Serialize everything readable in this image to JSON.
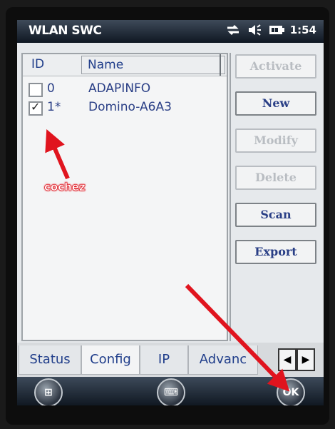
{
  "titlebar": {
    "title": "WLAN SWC",
    "time": "1:54",
    "icons": [
      "connectivity-icon",
      "volume-icon",
      "battery-icon"
    ]
  },
  "list": {
    "headers": {
      "id": "ID",
      "name": "Name"
    },
    "rows": [
      {
        "id": "0",
        "name": "ADAPINFO",
        "checked": false
      },
      {
        "id": "1*",
        "name": "Domino-A6A3",
        "checked": true
      }
    ]
  },
  "buttons": {
    "activate": "Activate",
    "new": "New",
    "modify": "Modify",
    "delete": "Delete",
    "scan": "Scan",
    "export": "Export"
  },
  "tabs": [
    "Status",
    "Config",
    "IP",
    "Advanc"
  ],
  "tab_nav": {
    "left": "◀",
    "right": "▶"
  },
  "bottombar": {
    "ok_label": "OK"
  },
  "annotation": {
    "note": "cochez",
    "color": "#e0141e"
  }
}
